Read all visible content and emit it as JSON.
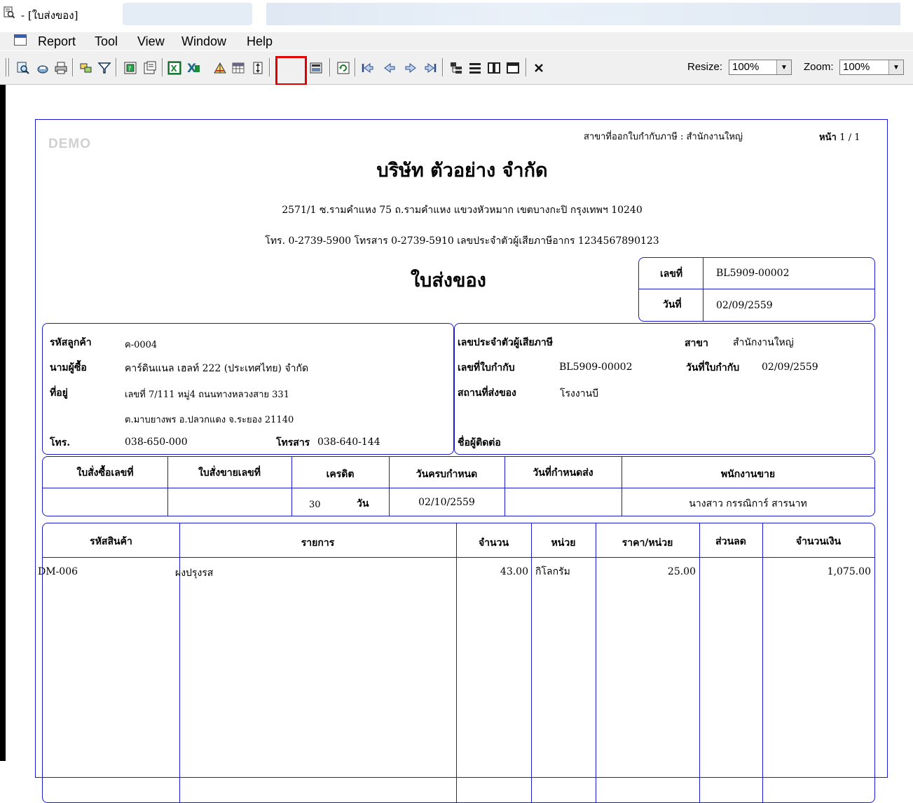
{
  "window": {
    "title": "- [ใบส่งของ]"
  },
  "menu": {
    "items": [
      "Report",
      "Tool",
      "View",
      "Window",
      "Help"
    ]
  },
  "toolbar": {
    "buttons": [
      "zoom-icon",
      "export-icon",
      "print-icon",
      "group-icon",
      "filter-icon",
      "design-icon",
      "layout-icon",
      "excel-icon",
      "excel-x-icon",
      "pdf-icon",
      "grid-icon",
      "fit-height-icon",
      "calculator-icon",
      "refresh-icon",
      "first-page-icon",
      "prev-page-icon",
      "next-page-icon",
      "last-page-icon",
      "tree-icon",
      "rows-icon",
      "columns-icon",
      "window-icon",
      "close-icon"
    ],
    "resize_label": "Resize:",
    "resize_value": "100%",
    "zoom_label": "Zoom:",
    "zoom_value": "100%",
    "highlight_color": "#e00000"
  },
  "report": {
    "watermark": "DEMO",
    "branch_issuer": "สาขาที่ออกใบกำกับภาษี : สำนักงานใหญ่",
    "page_label": "หน้า",
    "page_value": "1 / 1",
    "company": "บริษัท ตัวอย่าง จำกัด",
    "address": "2571/1 ซ.รามคำแหง 75 ถ.รามคำแหง แขวงหัวหมาก เขตบางกะปิ กรุงเทพฯ 10240",
    "contact": "โทร. 0-2739-5900  โทรสาร 0-2739-5910  เลขประจำตัวผู้เสียภาษีอากร 1234567890123",
    "doc_title": "ใบส่งของ",
    "doc_no_label": "เลขที่",
    "doc_no": "BL5909-00002",
    "doc_date_label": "วันที่",
    "doc_date": "02/09/2559",
    "customer": {
      "code_label": "รหัสลูกค้า",
      "code": "ค-0004",
      "buyer_label": "นามผู้ซื้อ",
      "buyer": "คาร์ดินแนล เฮลท์ 222 (ประเทศไทย) จำกัด",
      "addr_label": "ที่อยู่",
      "addr1": "เลขที่ 7/111 หมู่4 ถนนทางหลวงสาย 331",
      "addr2": "ต.มาบยางพร อ.ปลวกแดง จ.ระยอง 21140",
      "tel_label": "โทร.",
      "tel": "038-650-000",
      "fax_label": "โทรสาร",
      "fax": "038-640-144"
    },
    "tax": {
      "taxid_label": "เลขประจำตัวผู้เสียภาษี",
      "branch_label": "สาขา",
      "branch": "สำนักงานใหญ่",
      "invoice_label": "เลขที่ใบกำกับ",
      "invoice": "BL5909-00002",
      "invoice_date_label": "วันที่ใบกำกับ",
      "invoice_date": "02/09/2559",
      "ship_to_label": "สถานที่ส่งของ",
      "ship_to": "โรงงานบี",
      "contact_label": "ชื่อผู้ติดต่อ"
    },
    "terms": {
      "headers": [
        "ใบสั่งซื้อเลขที่",
        "ใบสั่งขายเลขที่",
        "เครดิต",
        "วันครบกำหนด",
        "วันที่กำหนดส่ง",
        "พนักงานขาย"
      ],
      "po": "",
      "so": "",
      "credit": "30",
      "credit_unit": "วัน",
      "due": "02/10/2559",
      "ship_date": "",
      "sales": "นางสาว กรรณิการ์ สารนาท"
    },
    "items": {
      "headers": [
        "รหัสสินค้า",
        "รายการ",
        "จำนวน",
        "หน่วย",
        "ราคา/หน่วย",
        "ส่วนลด",
        "จำนวนเงิน"
      ],
      "rows": [
        {
          "code": "DM-006",
          "desc": "ผงปรุงรส",
          "qty": "43.00",
          "unit": "กิโลกรัม",
          "price": "25.00",
          "discount": "",
          "amount": "1,075.00"
        }
      ]
    }
  }
}
